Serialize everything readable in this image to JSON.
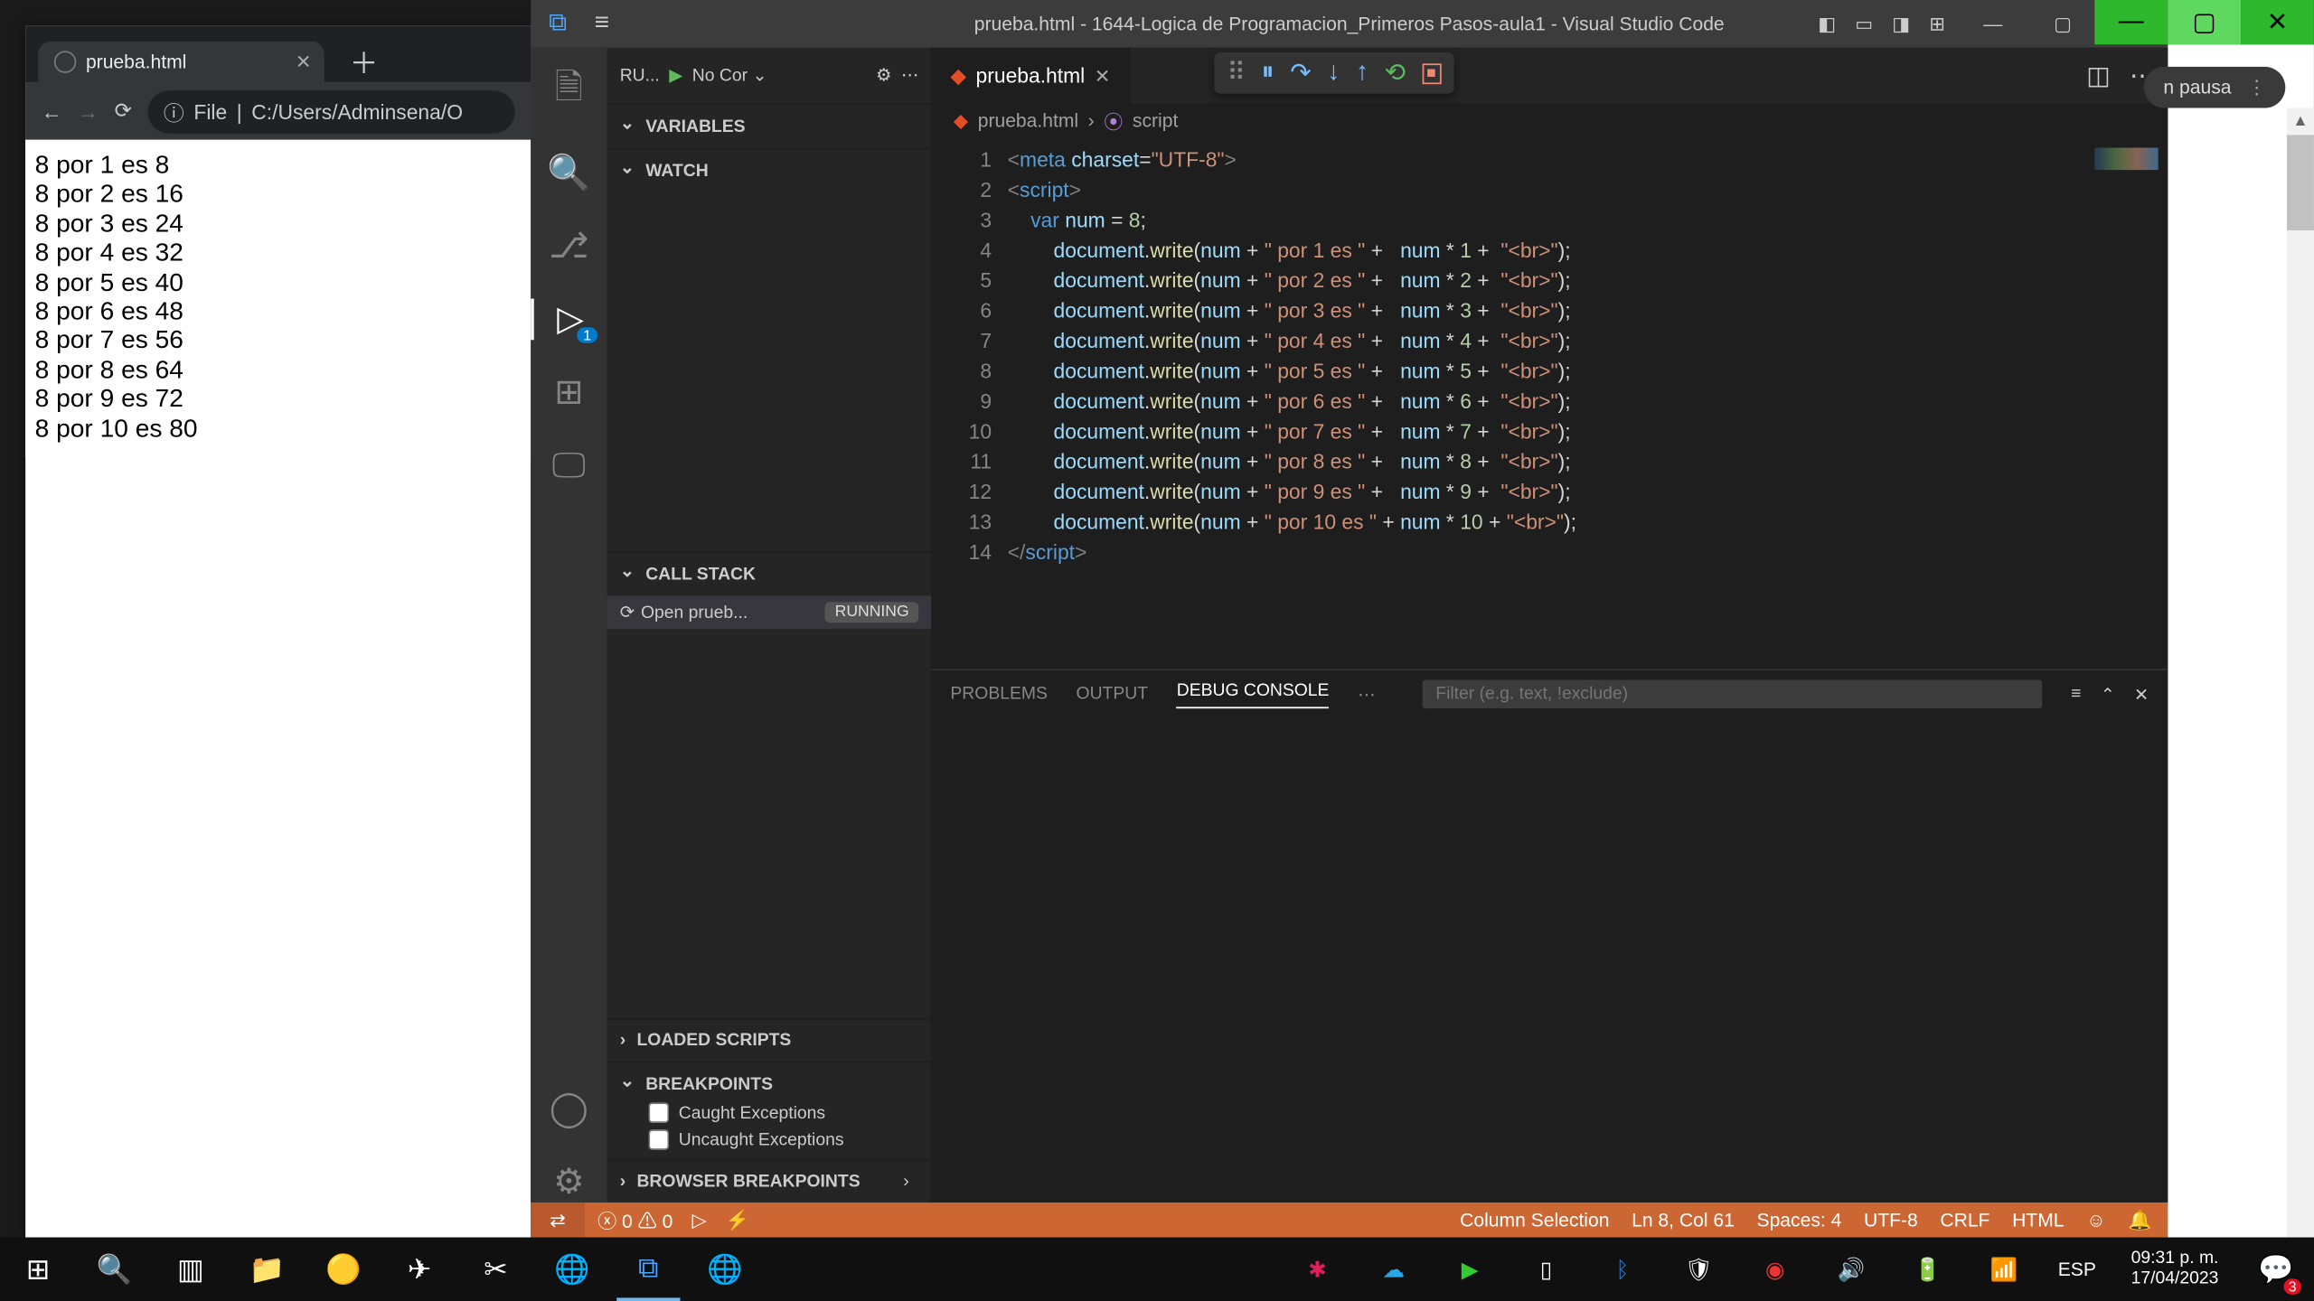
{
  "browser": {
    "tab_title": "prueba.html",
    "url_prefix": "File",
    "url_path": "C:/Users/Adminsena/O",
    "page_lines": [
      "8 por 1 es 8",
      "8 por 2 es 16",
      "8 por 3 es 24",
      "8 por 4 es 32",
      "8 por 5 es 40",
      "8 por 6 es 48",
      "8 por 7 es 56",
      "8 por 8 es 64",
      "8 por 9 es 72",
      "8 por 10 es 80"
    ]
  },
  "vscode": {
    "title": "prueba.html - 1644-Logica de Programacion_Primeros Pasos-aula1 - Visual Studio Code",
    "run_label": "RU...",
    "config_label": "No Cor",
    "badge": "1",
    "sections": {
      "variables": "VARIABLES",
      "watch": "WATCH",
      "callstack": "CALL STACK",
      "loaded": "LOADED SCRIPTS",
      "breakpoints": "BREAKPOINTS",
      "browserbp": "BROWSER BREAKPOINTS"
    },
    "callstack_item": "Open prueb...",
    "callstack_status": "RUNNING",
    "bp_caught": "Caught Exceptions",
    "bp_uncaught": "Uncaught Exceptions",
    "editor_tab": "prueba.html",
    "breadcrumb_file": "prueba.html",
    "breadcrumb_script": "script",
    "line_numbers": [
      "1",
      "2",
      "3",
      "4",
      "5",
      "6",
      "7",
      "8",
      "9",
      "10",
      "11",
      "12",
      "13",
      "14"
    ],
    "code_lines": {
      "l1": {
        "meta": "meta",
        "charset_attr": "charset",
        "charset_val": "\"UTF-8\""
      },
      "l2": {
        "tag": "script"
      },
      "l3": {
        "kw": "var",
        "v": "num",
        "eq": " = ",
        "n": "8",
        "sc": ";"
      },
      "dw_rows": [
        {
          "s": "\" por 1 es \"",
          "m": "1"
        },
        {
          "s": "\" por 2 es \"",
          "m": "2"
        },
        {
          "s": "\" por 3 es \"",
          "m": "3"
        },
        {
          "s": "\" por 4 es \"",
          "m": "4"
        },
        {
          "s": "\" por 5 es \"",
          "m": "5"
        },
        {
          "s": "\" por 6 es \"",
          "m": "6"
        },
        {
          "s": "\" por 7 es \"",
          "m": "7"
        },
        {
          "s": "\" por 8 es \"",
          "m": "8"
        },
        {
          "s": "\" por 9 es \"",
          "m": "9"
        }
      ],
      "dw_last": {
        "s": "\" por 10 es \"",
        "m": "10"
      },
      "br": "\"<br>\"",
      "obj": "document",
      "fn": "write",
      "num": "num",
      "l14": {
        "tag": "script"
      }
    },
    "panel": {
      "problems": "PROBLEMS",
      "output": "OUTPUT",
      "debug": "DEBUG CONSOLE",
      "filter_ph": "Filter (e.g. text, !exclude)"
    },
    "status": {
      "errors": "0",
      "warnings": "0",
      "colsel": "Column Selection",
      "lncol": "Ln 8, Col 61",
      "spaces": "Spaces: 4",
      "enc": "UTF-8",
      "eol": "CRLF",
      "lang": "HTML"
    }
  },
  "pill_right": "n pausa",
  "taskbar": {
    "lang": "ESP",
    "time": "09:31 p. m.",
    "date": "17/04/2023",
    "notif": "3"
  }
}
